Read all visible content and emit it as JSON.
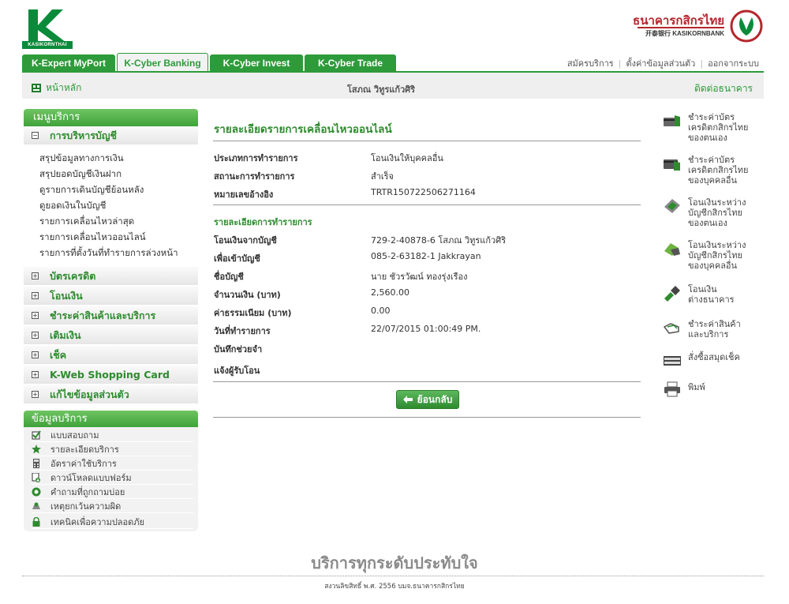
{
  "brand": {
    "logo_text": "KASIKORNTHAI",
    "bank_name_th": "ธนาคารกสิกรไทย",
    "bank_name_en": "开泰银行 KASIKORNBANK",
    "accent_color": "#2e9b3a",
    "bank_red": "#b5262d"
  },
  "tabs": [
    {
      "label": "K-Expert MyPort",
      "active": false
    },
    {
      "label": "K-Cyber Banking",
      "active": true
    },
    {
      "label": "K-Cyber Invest",
      "active": false
    },
    {
      "label": "K-Cyber Trade",
      "active": false
    }
  ],
  "top_links": {
    "register": "สมัครบริการ",
    "settings": "ตั้งค่าข้อมูลส่วนตัว",
    "logout": "ออกจากระบบ"
  },
  "subbar": {
    "home": "หน้าหลัก",
    "user": "โสภณ วิทูรแก้วศิริ",
    "contact": "ติดต่อธนาคาร"
  },
  "left_menu": {
    "header": "เมนูบริการ",
    "account_section": "การบริหารบัญชี",
    "account_items": [
      "สรุปข้อมูลทางการเงิน",
      "สรุปยอดบัญชีเงินฝาก",
      "ดูรายการเดินบัญชีย้อนหลัง",
      "ดูยอดเงินในบัญชี",
      "รายการเคลื่อนไหวล่าสุด",
      "รายการเคลื่อนไหวออนไลน์",
      "รายการที่ตั้งวันที่ทำรายการล่วงหน้า"
    ],
    "sections": [
      "บัตรเครดิต",
      "โอนเงิน",
      "ชำระค่าสินค้าและบริการ",
      "เติมเงิน",
      "เช็ค",
      "K-Web Shopping Card",
      "แก้ไขข้อมูลส่วนตัว"
    ]
  },
  "info_menu": {
    "header": "ข้อมูลบริการ",
    "items": [
      {
        "label": "แบบสอบถาม",
        "icon": "checkbox-icon"
      },
      {
        "label": "รายละเอียดบริการ",
        "icon": "star-icon"
      },
      {
        "label": "อัตราค่าใช้บริการ",
        "icon": "calculator-icon"
      },
      {
        "label": "ดาวน์โหลดแบบฟอร์ม",
        "icon": "download-icon"
      },
      {
        "label": "คำถามที่ถูกถามบ่อย",
        "icon": "faq-icon"
      },
      {
        "label": "เหตุยกเว้นความผิด",
        "icon": "disclaimer-icon"
      },
      {
        "label": "เทคนิคเพื่อความปลอดภัย",
        "icon": "lock-icon"
      }
    ]
  },
  "detail": {
    "title": "รายละเอียดรายการเคลื่อนไหวออนไลน์",
    "summary": [
      {
        "label": "ประเภทการทำรายการ",
        "value": "โอนเงินให้บุคคลอื่น"
      },
      {
        "label": "สถานะการทำรายการ",
        "value": "สำเร็จ"
      },
      {
        "label": "หมายเลขอ้างอิง",
        "value": "TRTR150722506271164"
      }
    ],
    "section_title": "รายละเอียดการทำรายการ",
    "rows": [
      {
        "label": "โอนเงินจากบัญชี",
        "value": "729-2-40878-6 โสภณ วิทูรแก้วศิริ"
      },
      {
        "label": "เพื่อเข้าบัญชี",
        "value": "085-2-63182-1 Jakkrayan"
      },
      {
        "label": "ชื่อบัญชี",
        "value": "นาย ชัวรวัฒน์ ทองรุ่งเรือง"
      },
      {
        "label": "จำนวนเงิน (บาท)",
        "value": "2,560.00"
      },
      {
        "label": "ค่าธรรมเนียม (บาท)",
        "value": "0.00"
      },
      {
        "label": "วันที่ทำรายการ",
        "value": "22/07/2015 01:00:49 PM."
      },
      {
        "label": "บันทึกช่วยจำ",
        "value": ""
      },
      {
        "label": "แจ้งผู้รับโอน",
        "value": ""
      }
    ],
    "back_label": "ย้อนกลับ"
  },
  "quick_links": [
    {
      "lines": [
        "ชำระค่าบัตร",
        "เครดิตกสิกรไทย",
        "ของตนเอง"
      ],
      "icon": "card-pay-icon"
    },
    {
      "lines": [
        "ชำระค่าบัตร",
        "เครดิตกสิกรไทย",
        "ของบุคคลอื่น"
      ],
      "icon": "card-pay-other-icon"
    },
    {
      "lines": [
        "โอนเงินระหว่าง",
        "บัญชีกสิกรไทย",
        "ของตนเอง"
      ],
      "icon": "transfer-own-icon"
    },
    {
      "lines": [
        "โอนเงินระหว่าง",
        "บัญชีกสิกรไทย",
        "ของบุคคลอื่น"
      ],
      "icon": "transfer-other-icon"
    },
    {
      "lines": [
        "โอนเงิน",
        "ต่างธนาคาร"
      ],
      "icon": "interbank-icon"
    },
    {
      "lines": [
        "ชำระค่าสินค้า",
        "และบริการ"
      ],
      "icon": "bill-pay-icon"
    },
    {
      "lines": [
        "สั่งซื้อสมุดเช็ค"
      ],
      "icon": "cheque-book-icon"
    },
    {
      "lines": [
        "พิมพ์"
      ],
      "icon": "printer-icon"
    }
  ],
  "footer": {
    "slogan": "บริการทุกระดับประทับใจ",
    "copyright": "สงวนลิขสิทธิ์ พ.ศ. 2556 บมจ.ธนาคารกสิกรไทย"
  }
}
